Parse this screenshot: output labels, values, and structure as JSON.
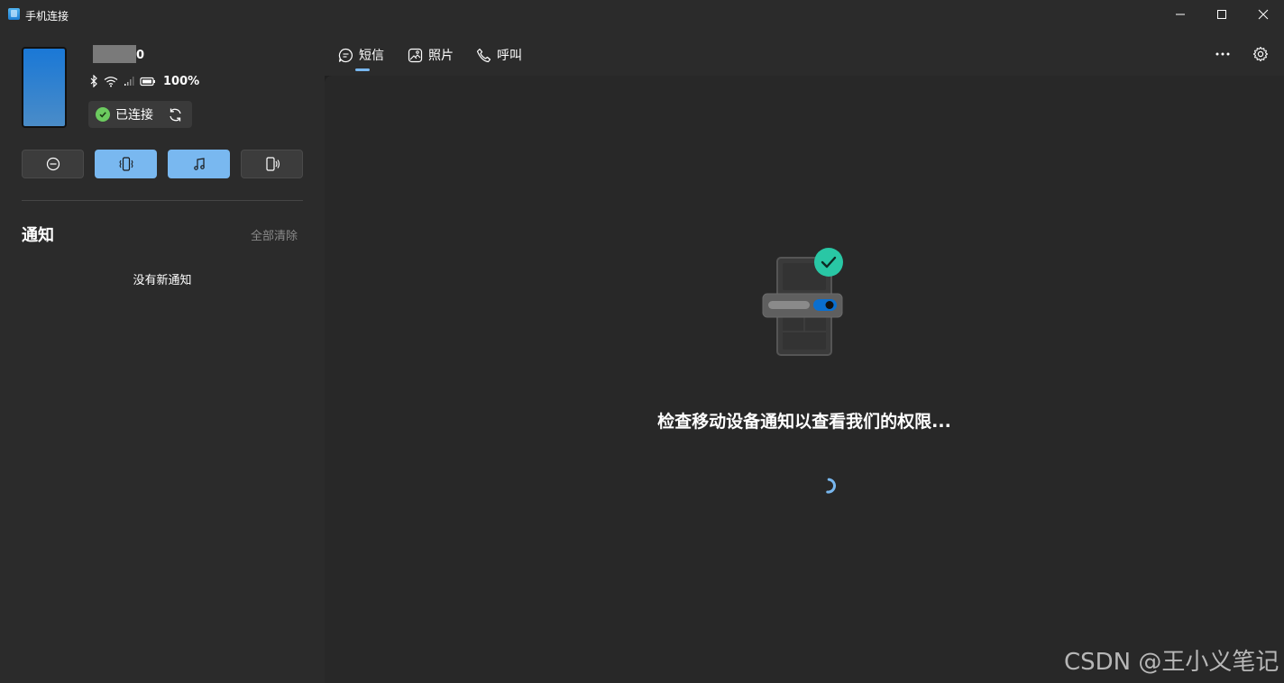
{
  "window": {
    "title": "手机连接",
    "accent": "#78b7ef"
  },
  "device": {
    "name_suffix": "0",
    "battery": "100%",
    "connection_status": "已连接",
    "status_color": "#6ccb5f"
  },
  "quick_actions": [
    {
      "icon": "do-not-disturb-icon",
      "active": false
    },
    {
      "icon": "vibrate-icon",
      "active": true
    },
    {
      "icon": "music-icon",
      "active": true
    },
    {
      "icon": "phone-audio-icon",
      "active": false
    }
  ],
  "notifications": {
    "title": "通知",
    "clear_all": "全部清除",
    "empty_text": "没有新通知"
  },
  "tabs": [
    {
      "label": "短信",
      "icon": "message-icon",
      "selected": true
    },
    {
      "label": "照片",
      "icon": "photo-icon",
      "selected": false
    },
    {
      "label": "呼叫",
      "icon": "phone-icon",
      "selected": false
    }
  ],
  "main": {
    "message": "检查移动设备通知以查看我们的权限..."
  },
  "watermark": "CSDN @王小义笔记"
}
